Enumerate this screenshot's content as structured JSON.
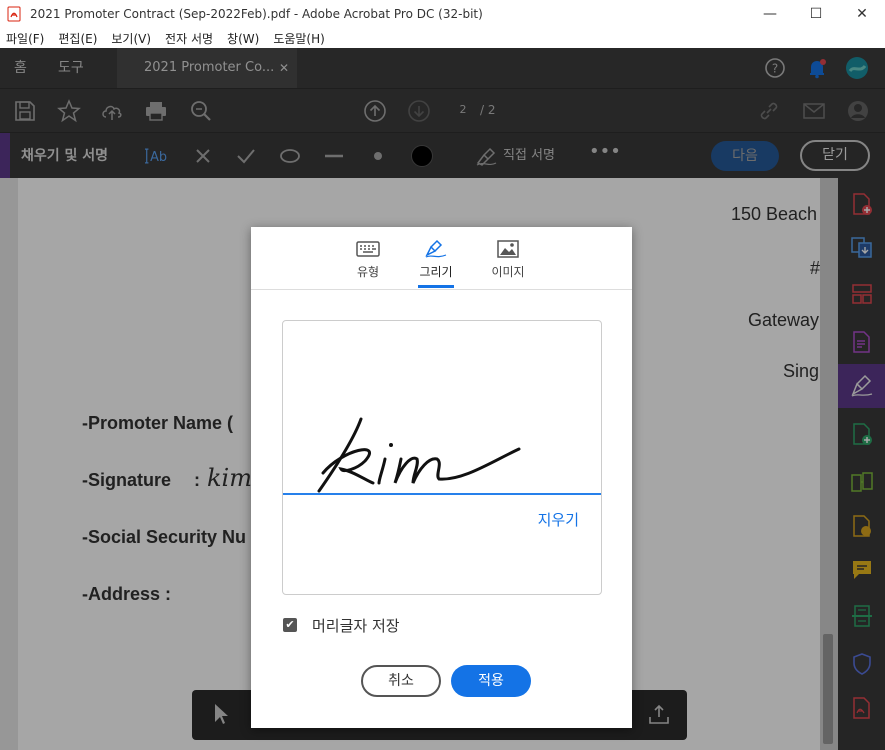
{
  "window": {
    "title": "2021 Promoter Contract (Sep-2022Feb).pdf - Adobe Acrobat Pro DC (32-bit)",
    "minimize": "—",
    "maximize": "☐",
    "close": "✕"
  },
  "menu": [
    "파일(F)",
    "편집(E)",
    "보기(V)",
    "전자 서명",
    "창(W)",
    "도움말(H)"
  ],
  "tabs": {
    "home": "홈",
    "tools": "도구",
    "document": "2021 Promoter Co...",
    "close": "✕"
  },
  "toolbar": {
    "page_current": "2",
    "page_total": "/ 2"
  },
  "fill_sign": {
    "title": "채우기 및 서명",
    "sign_label": "직접 서명",
    "more": "•••",
    "next_button": "다음",
    "close_button": "닫기"
  },
  "document": {
    "address_lines": [
      "150 Beach",
      "#",
      "Gateway",
      "Sing"
    ],
    "promoter_name": "-Promoter Name (",
    "signature_label": "-Signature",
    "signature_colon": ":",
    "signature_value": "kim",
    "ssn_label": "-Social Security Nu",
    "address_label": "-Address :"
  },
  "dialog": {
    "tabs": [
      {
        "label": "유형",
        "icon": "keyboard-icon"
      },
      {
        "label": "그리기",
        "icon": "pen-draw-icon"
      },
      {
        "label": "이미지",
        "icon": "image-icon"
      }
    ],
    "active_tab": "그리기",
    "signature_drawn": "kim",
    "clear_label": "지우기",
    "save_initials_label": "머리글자 저장",
    "save_initials_checked": true,
    "cancel_button": "취소",
    "apply_button": "적용"
  },
  "colors": {
    "accent_blue": "#1473e6",
    "purple": "#5c3a8a",
    "dark_bg": "#3c3c3c"
  }
}
